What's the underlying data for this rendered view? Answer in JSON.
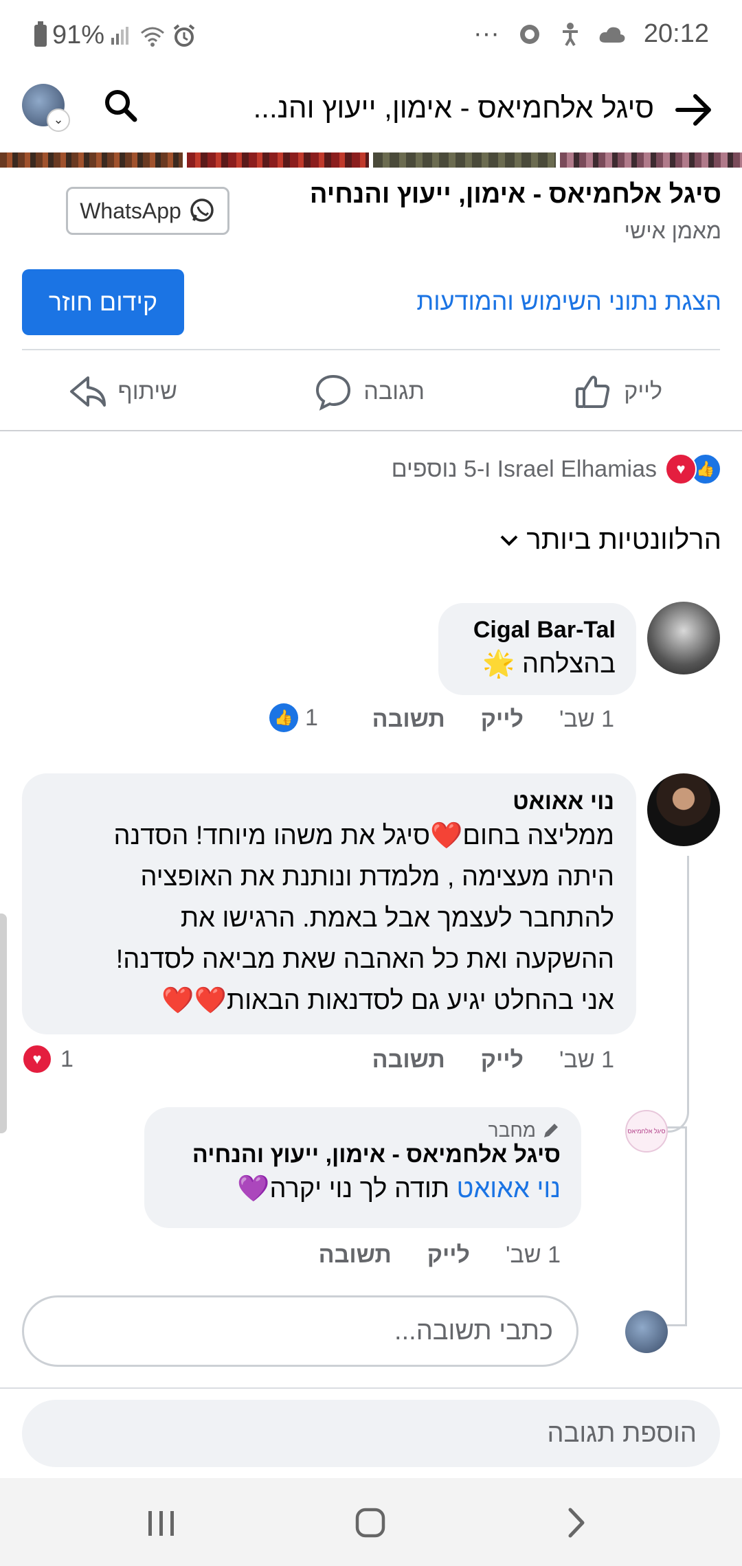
{
  "status_bar": {
    "battery": "91%",
    "time": "20:12",
    "dots": "···"
  },
  "header": {
    "title": "סיגל אלחמיאס - אימון, ייעוץ והנ..."
  },
  "page": {
    "name": "סיגל אלחמיאס - אימון, ייעוץ והנחיה",
    "category": "מאמן אישי",
    "whatsapp_label": "WhatsApp",
    "insights_link": "הצגת נתוני השימוש והמודעות",
    "boost_label": "קידום חוזר"
  },
  "actions": {
    "like": "לייק",
    "comment": "תגובה",
    "share": "שיתוף"
  },
  "reactions_summary": "Israel Elhamias ו-5 נוספים",
  "sort_label": "הרלוונטיות ביותר",
  "comments": [
    {
      "author": "Cigal Bar-Tal",
      "text": "בהצלחה 🌟",
      "time": "1 שב'",
      "like": "לייק",
      "reply": "תשובה",
      "reaction_count": "1"
    },
    {
      "author": "נוי אאואט",
      "lines": [
        "ממליצה בחום❤️סיגל את משהו מיוחד! הסדנה",
        "היתה מעצימה , מלמדת  ונותנת את האופציה",
        "להתחבר לעצמך אבל באמת. הרגישו את",
        "ההשקעה ואת כל האהבה שאת מביאה לסדנה!",
        "אני בהחלט יגיע גם לסדנאות הבאות❤️❤️"
      ],
      "time": "1 שב'",
      "like": "לייק",
      "reply": "תשובה",
      "reaction_count": "1"
    }
  ],
  "reply": {
    "badge": "מחבר",
    "author": "סיגל אלחמיאס - אימון, ייעוץ והנחיה",
    "mention": "נוי אאואט",
    "text": " תודה לך נוי יקרה💜",
    "time": "1 שב'",
    "like": "לייק",
    "reply": "תשובה",
    "avatar_text": "סיגל אלחמיאס"
  },
  "reply_input_placeholder": "כתבי תשובה...",
  "add_comment_placeholder": "הוספת תגובה",
  "colors": {
    "accent": "#1b74e4",
    "heart": "#e41e3f",
    "bubble": "#f0f2f5"
  }
}
